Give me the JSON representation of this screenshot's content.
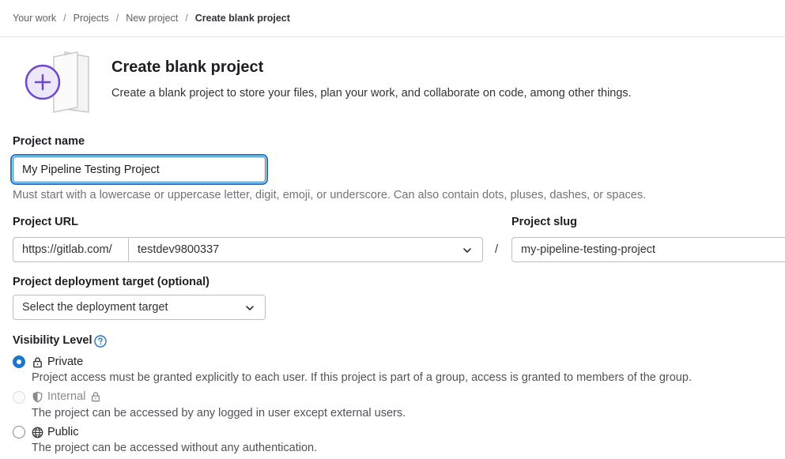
{
  "breadcrumb": {
    "items": [
      "Your work",
      "Projects",
      "New project"
    ],
    "current": "Create blank project",
    "separator": "/"
  },
  "hero": {
    "title": "Create blank project",
    "description": "Create a blank project to store your files, plan your work, and collaborate on code, among other things.",
    "icon": "plus-circle-illustration"
  },
  "form": {
    "project_name": {
      "label": "Project name",
      "value": "My Pipeline Testing Project",
      "help": "Must start with a lowercase or uppercase letter, digit, emoji, or underscore. Can also contain dots, pluses, dashes, or spaces."
    },
    "project_url": {
      "label": "Project URL",
      "prefix": "https://gitlab.com/",
      "namespace": "testdev9800337",
      "separator": "/"
    },
    "project_slug": {
      "label": "Project slug",
      "value": "my-pipeline-testing-project"
    },
    "deployment": {
      "label": "Project deployment target (optional)",
      "placeholder": "Select the deployment target"
    },
    "visibility": {
      "label": "Visibility Level",
      "options": [
        {
          "label": "Private",
          "description": "Project access must be granted explicitly to each user. If this project is part of a group, access is granted to members of the group.",
          "icon": "lock-icon",
          "checked": true,
          "disabled": false
        },
        {
          "label": "Internal",
          "description": "The project can be accessed by any logged in user except external users.",
          "icon": "shield-icon",
          "checked": false,
          "disabled": true
        },
        {
          "label": "Public",
          "description": "The project can be accessed without any authentication.",
          "icon": "globe-icon",
          "checked": false,
          "disabled": false
        }
      ]
    }
  },
  "colors": {
    "accent": "#1f75cb",
    "illustration_purple": "#6e49cb"
  }
}
